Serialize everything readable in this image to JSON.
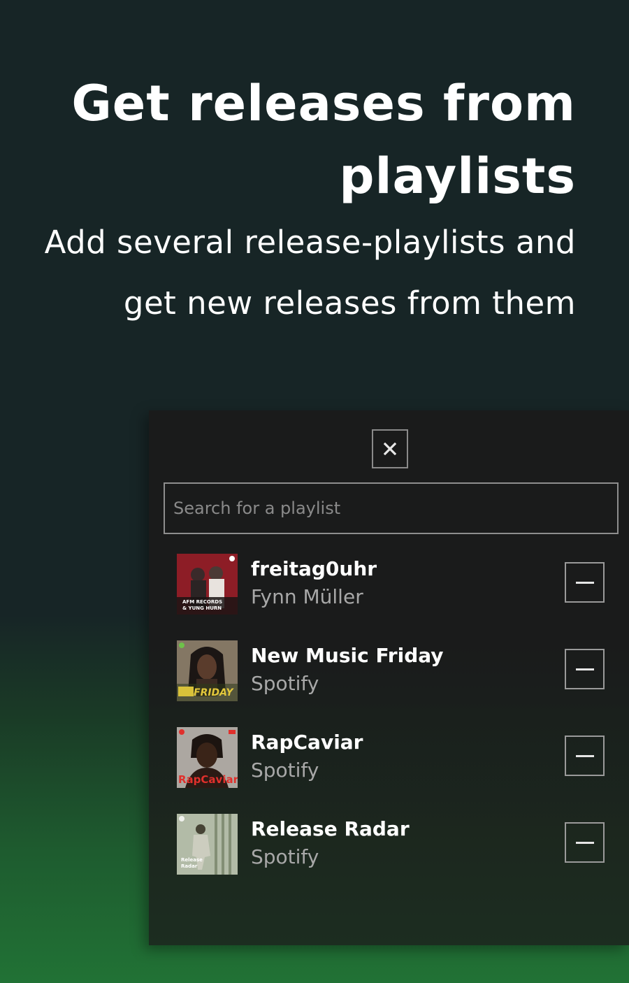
{
  "hero": {
    "title_line1": "Get releases from",
    "title_line2": "playlists",
    "subtitle_line1": "Add several release-playlists and",
    "subtitle_line2": "get new releases from them"
  },
  "dialog": {
    "close_icon": "close-icon",
    "search": {
      "placeholder": "Search for a playlist",
      "value": ""
    },
    "playlists": [
      {
        "title": "freitag0uhr",
        "owner": "Fynn Müller",
        "cover_text": "AFM RECORDS & YUNG HURN",
        "accent": "#c0282d"
      },
      {
        "title": "New Music Friday",
        "owner": "Spotify",
        "cover_text": "FRIDAY",
        "accent": "#d9c23a"
      },
      {
        "title": "RapCaviar",
        "owner": "Spotify",
        "cover_text": "RapCaviar",
        "accent": "#e0302c"
      },
      {
        "title": "Release Radar",
        "owner": "Spotify",
        "cover_text": "Release Radar",
        "accent": "#cfd8c6"
      }
    ],
    "remove_icon": "minus-icon"
  },
  "colors": {
    "background_top": "#172526",
    "background_bottom": "#217235",
    "dialog_background": "#1b1b1b",
    "owner_text": "#a8a8a8",
    "border": "#8e8e8e"
  }
}
